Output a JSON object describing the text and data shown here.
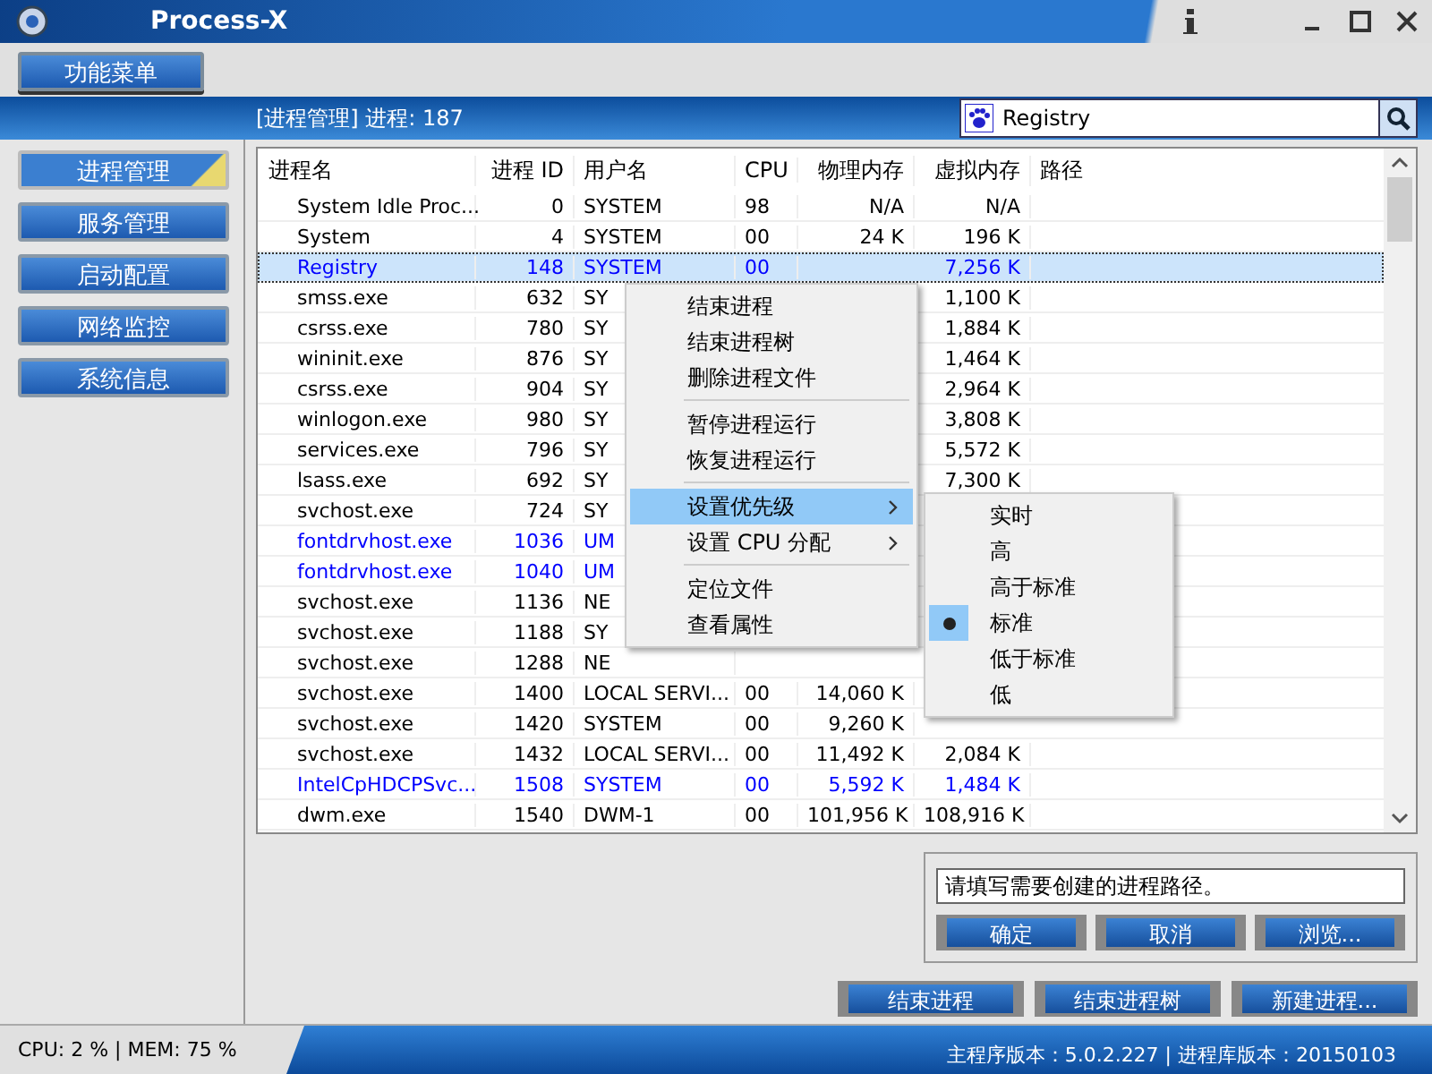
{
  "window": {
    "title": "Process-X"
  },
  "menu_button": "功能菜单",
  "header": {
    "title": "[进程管理] 进程: 187",
    "search": {
      "value": "Registry"
    }
  },
  "sidebar": {
    "items": [
      {
        "label": "进程管理",
        "selected": true
      },
      {
        "label": "服务管理",
        "selected": false
      },
      {
        "label": "启动配置",
        "selected": false
      },
      {
        "label": "网络监控",
        "selected": false
      },
      {
        "label": "系统信息",
        "selected": false
      }
    ]
  },
  "table": {
    "columns": [
      "进程名",
      "进程 ID",
      "用户名",
      "CPU",
      "物理内存",
      "虚拟内存",
      "路径"
    ],
    "rows": [
      {
        "cells": [
          "System Idle Proc...",
          "0",
          "SYSTEM",
          "98",
          "N/A",
          "N/A"
        ],
        "color": "#000000",
        "selected": false
      },
      {
        "cells": [
          "System",
          "4",
          "SYSTEM",
          "00",
          "24 K",
          "196 K"
        ],
        "color": "#000000",
        "selected": false
      },
      {
        "cells": [
          "Registry",
          "148",
          "SYSTEM",
          "00",
          null,
          "7,256 K"
        ],
        "color": "#0000ff",
        "selected": true
      },
      {
        "cells": [
          "smss.exe",
          "632",
          "SY",
          null,
          null,
          "1,100 K"
        ],
        "color": "#000000",
        "selected": false
      },
      {
        "cells": [
          "csrss.exe",
          "780",
          "SY",
          null,
          null,
          "1,884 K"
        ],
        "color": "#000000",
        "selected": false
      },
      {
        "cells": [
          "wininit.exe",
          "876",
          "SY",
          null,
          null,
          "1,464 K"
        ],
        "color": "#000000",
        "selected": false
      },
      {
        "cells": [
          "csrss.exe",
          "904",
          "SY",
          null,
          null,
          "2,964 K"
        ],
        "color": "#000000",
        "selected": false
      },
      {
        "cells": [
          "winlogon.exe",
          "980",
          "SY",
          null,
          null,
          "3,808 K"
        ],
        "color": "#000000",
        "selected": false
      },
      {
        "cells": [
          "services.exe",
          "796",
          "SY",
          null,
          null,
          "5,572 K"
        ],
        "color": "#000000",
        "selected": false
      },
      {
        "cells": [
          "lsass.exe",
          "692",
          "SY",
          null,
          null,
          "7,300 K"
        ],
        "color": "#000000",
        "selected": false
      },
      {
        "cells": [
          "svchost.exe",
          "724",
          "SY",
          null,
          null,
          null
        ],
        "color": "#000000",
        "selected": false
      },
      {
        "cells": [
          "fontdrvhost.exe",
          "1036",
          "UM",
          null,
          null,
          null
        ],
        "color": "#0000ff",
        "selected": false
      },
      {
        "cells": [
          "fontdrvhost.exe",
          "1040",
          "UM",
          null,
          null,
          null
        ],
        "color": "#0000ff",
        "selected": false
      },
      {
        "cells": [
          "svchost.exe",
          "1136",
          "NE",
          null,
          null,
          null
        ],
        "color": "#000000",
        "selected": false
      },
      {
        "cells": [
          "svchost.exe",
          "1188",
          "SY",
          null,
          null,
          null
        ],
        "color": "#000000",
        "selected": false
      },
      {
        "cells": [
          "svchost.exe",
          "1288",
          "NE",
          null,
          null,
          null
        ],
        "color": "#000000",
        "selected": false
      },
      {
        "cells": [
          "svchost.exe",
          "1400",
          "LOCAL SERVI...",
          "00",
          "14,060 K",
          null
        ],
        "color": "#000000",
        "selected": false
      },
      {
        "cells": [
          "svchost.exe",
          "1420",
          "SYSTEM",
          "00",
          "9,260 K",
          null
        ],
        "color": "#000000",
        "selected": false
      },
      {
        "cells": [
          "svchost.exe",
          "1432",
          "LOCAL SERVI...",
          "00",
          "11,492 K",
          "2,084 K"
        ],
        "color": "#000000",
        "selected": false
      },
      {
        "cells": [
          "IntelCpHDCPSvc...",
          "1508",
          "SYSTEM",
          "00",
          "5,592 K",
          "1,484 K"
        ],
        "color": "#0000ff",
        "selected": false
      },
      {
        "cells": [
          "dwm.exe",
          "1540",
          "DWM-1",
          "00",
          "101,956 K",
          "108,916 K"
        ],
        "color": "#000000",
        "selected": false
      }
    ]
  },
  "context_menu": {
    "items": [
      {
        "kind": "item",
        "label": "结束进程",
        "selected": false,
        "submenu": false
      },
      {
        "kind": "item",
        "label": "结束进程树",
        "selected": false,
        "submenu": false
      },
      {
        "kind": "item",
        "label": "删除进程文件",
        "selected": false,
        "submenu": false
      },
      {
        "kind": "separator"
      },
      {
        "kind": "item",
        "label": "暂停进程运行",
        "selected": false,
        "submenu": false
      },
      {
        "kind": "item",
        "label": "恢复进程运行",
        "selected": false,
        "submenu": false
      },
      {
        "kind": "separator"
      },
      {
        "kind": "item",
        "label": "设置优先级",
        "selected": true,
        "submenu": true
      },
      {
        "kind": "item",
        "label": "设置 CPU 分配",
        "selected": false,
        "submenu": true
      },
      {
        "kind": "separator"
      },
      {
        "kind": "item",
        "label": "定位文件",
        "selected": false,
        "submenu": false
      },
      {
        "kind": "item",
        "label": "查看属性",
        "selected": false,
        "submenu": false
      }
    ]
  },
  "priority_menu": {
    "items": [
      {
        "label": "实时",
        "selected": false
      },
      {
        "label": "高",
        "selected": false
      },
      {
        "label": "高于标准",
        "selected": false
      },
      {
        "label": "标准",
        "selected": true
      },
      {
        "label": "低于标准",
        "selected": false
      },
      {
        "label": "低",
        "selected": false
      }
    ]
  },
  "new_process": {
    "placeholder": "请填写需要创建的进程路径。",
    "buttons": [
      "确定",
      "取消",
      "浏览..."
    ]
  },
  "actions": [
    "结束进程",
    "结束进程树",
    "新建进程..."
  ],
  "status_bar": {
    "left": "CPU: 2 % | MEM: 75 %",
    "right": "主程序版本：5.0.2.227 | 进程库版本：20150103"
  }
}
